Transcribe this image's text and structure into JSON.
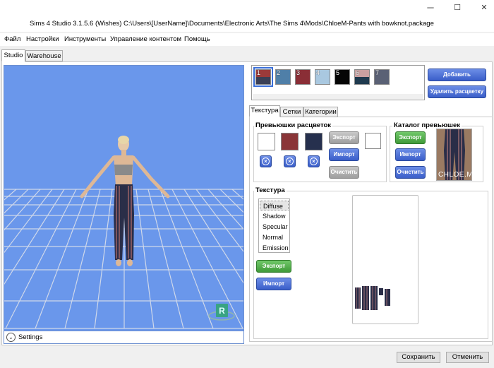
{
  "window": {
    "title": "Sims 4 Studio 3.1.5.6 (Wishes)  C:\\Users\\[UserName]\\Documents\\Electronic Arts\\The Sims 4\\Mods\\ChloeM-Pants with bowknot.package",
    "minimize": "─",
    "maximize": "☐",
    "close": "✕"
  },
  "menu": {
    "items": [
      "Файл",
      "Настройки",
      "Инструменты",
      "Управление контентом",
      "Помощь"
    ]
  },
  "main_tabs": [
    "Studio",
    "Warehouse"
  ],
  "viewport": {
    "settings_label": "Settings",
    "settings_icon": "chevron-down-icon",
    "background_color": "#6a97eb",
    "grid_color": "#cfd8ea"
  },
  "swatches": [
    {
      "num": "1",
      "color": "#3a3f55",
      "color2": "#9a3a3a",
      "selected": true
    },
    {
      "num": "2",
      "color": "#4f7fa8"
    },
    {
      "num": "3",
      "color": "#8a2e36"
    },
    {
      "num": "4",
      "color": "#a9c8e0"
    },
    {
      "num": "5",
      "color": "#050505"
    },
    {
      "num": "6",
      "color": "#1f3a4e",
      "color2": "#caa0a0"
    },
    {
      "num": "7",
      "color": "#5a6175"
    }
  ],
  "swatch_buttons": {
    "add": "Добавить расцветку",
    "remove": "Удалить расцветку"
  },
  "sub_tabs": [
    "Текстура",
    "Сетки",
    "Категории"
  ],
  "thumbnails": {
    "title": "Превьюшки расцветок",
    "boxes": [
      "#ffffff",
      "#8a3538",
      "#26304e"
    ],
    "export": "Экспорт",
    "import": "Импорт",
    "clear": "Очистить",
    "extra_box": "#ffffff"
  },
  "catalog": {
    "title": "Каталог превьюшек",
    "export": "Экспорт",
    "import": "Импорт",
    "clear": "Очистить",
    "watermark": "CHLOE.M"
  },
  "texture": {
    "title": "Текстура",
    "list": [
      "Diffuse",
      "Shadow",
      "Specular",
      "Normal",
      "Emission"
    ],
    "selected": "Diffuse",
    "export": "Экспорт",
    "import": "Импорт"
  },
  "footer": {
    "save": "Сохранить",
    "cancel": "Отменить"
  }
}
